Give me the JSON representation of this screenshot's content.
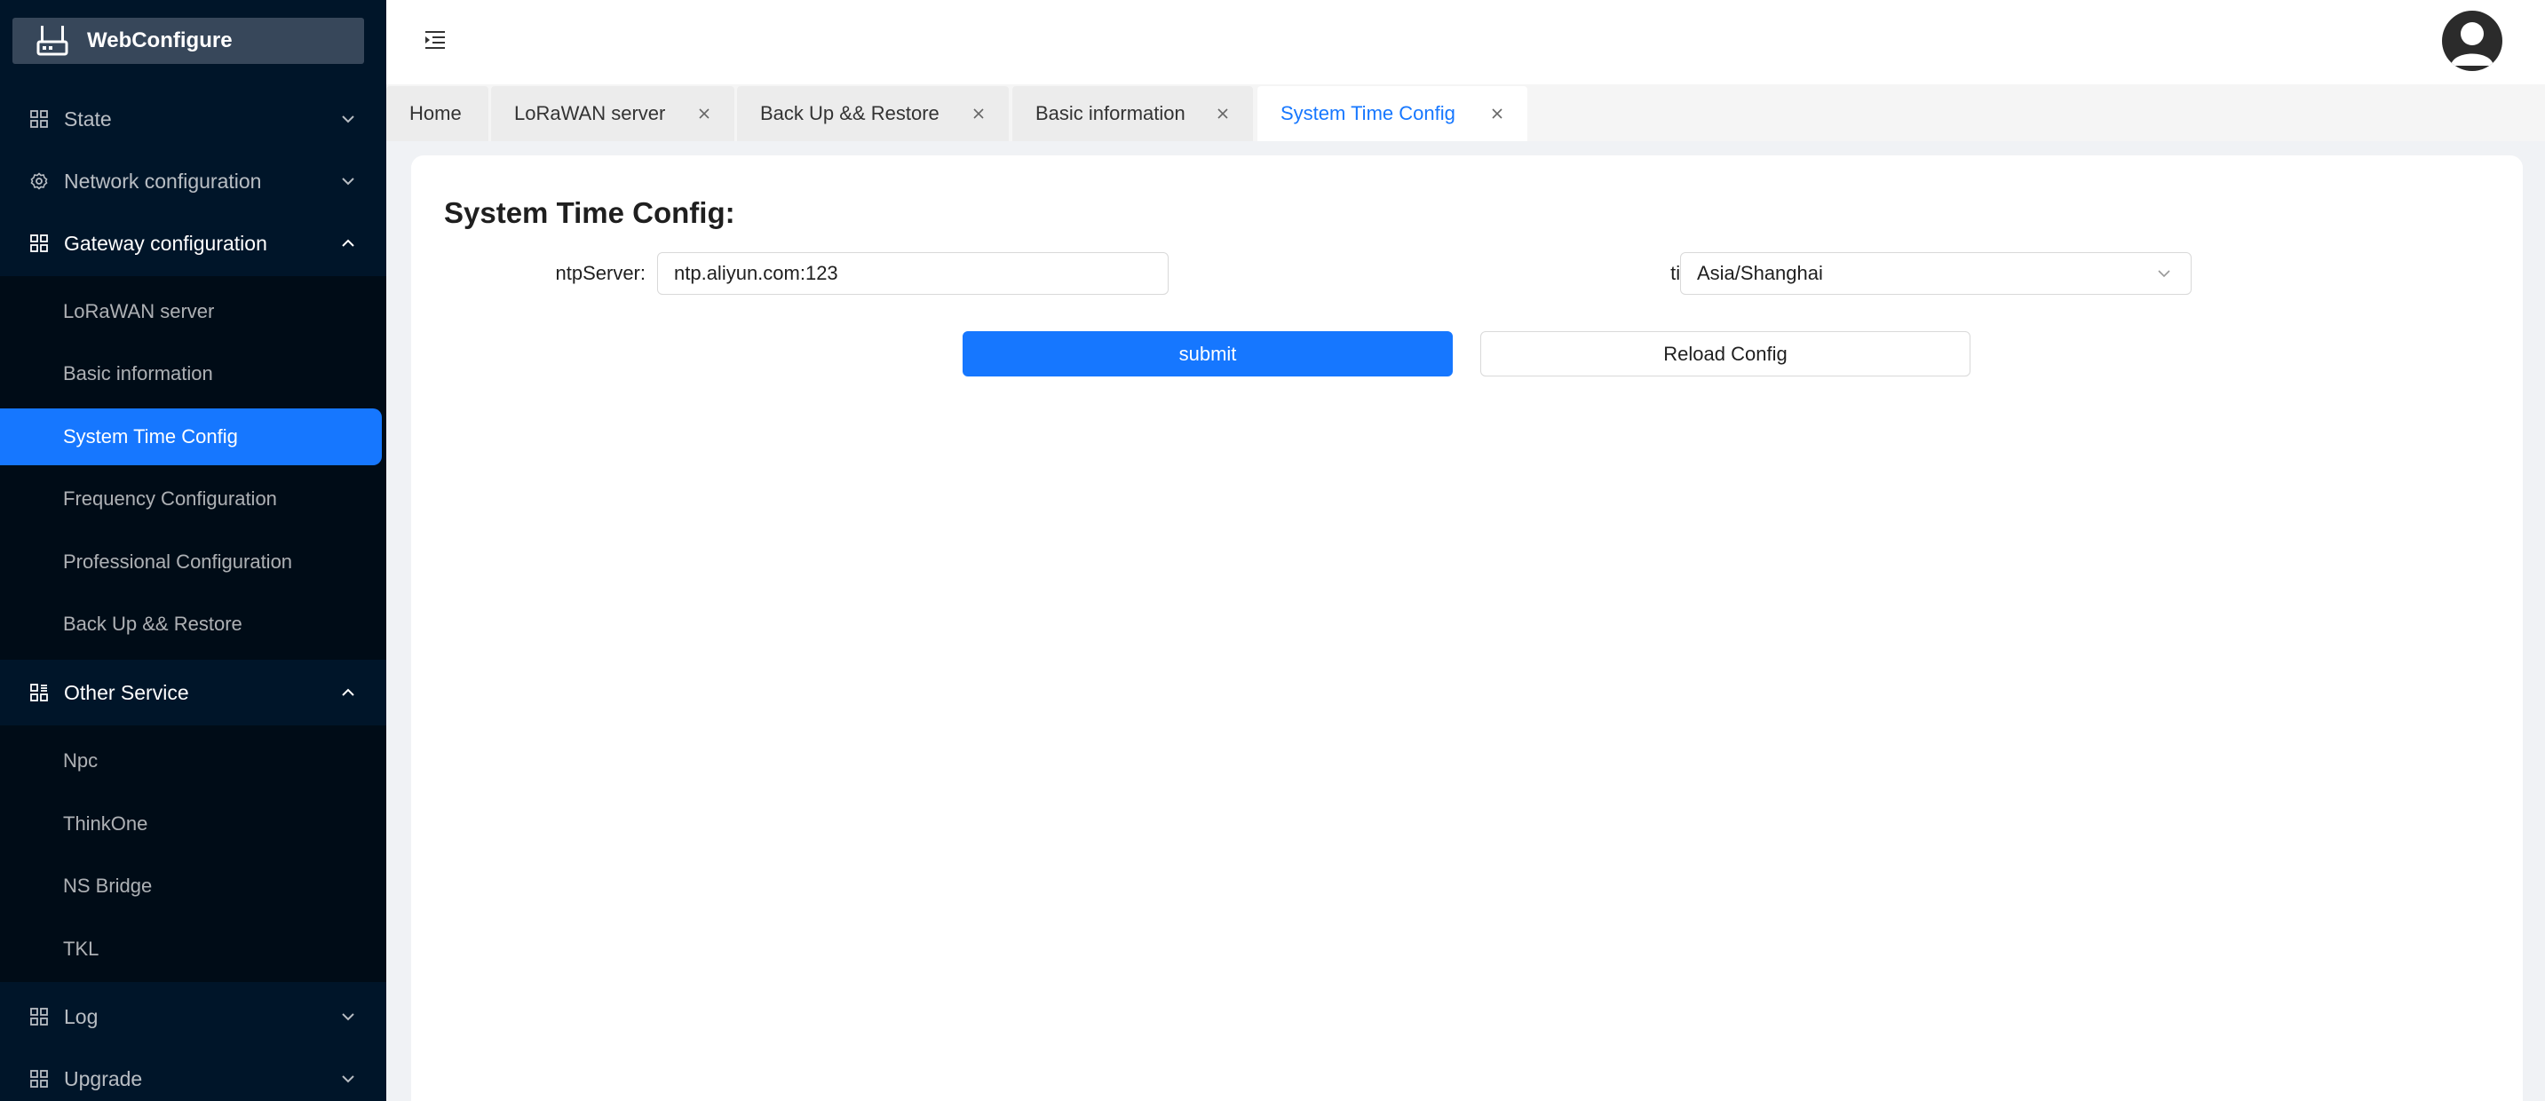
{
  "app": {
    "logo_text": "WebConfigure"
  },
  "sidebar": {
    "groups": {
      "state": {
        "label": "State"
      },
      "network": {
        "label": "Network configuration"
      },
      "gateway": {
        "label": "Gateway configuration",
        "items": [
          "LoRaWAN server",
          "Basic information",
          "System Time Config",
          "Frequency Configuration",
          "Professional Configuration",
          "Back Up && Restore"
        ]
      },
      "other": {
        "label": "Other Service",
        "items": [
          "Npc",
          "ThinkOne",
          "NS Bridge",
          "TKL"
        ]
      },
      "log": {
        "label": "Log"
      },
      "upgrade": {
        "label": "Upgrade"
      }
    },
    "active_item": "System Time Config"
  },
  "tabs": [
    {
      "label": "Home"
    },
    {
      "label": "LoRaWAN server"
    },
    {
      "label": "Back Up && Restore"
    },
    {
      "label": "Basic information"
    },
    {
      "label": "System Time Config"
    }
  ],
  "form": {
    "title": "System Time Config:",
    "ntp_label": "ntpServer:",
    "ntp_value": "ntp.aliyun.com:123",
    "timezone_label": "timeZone:",
    "timezone_value": "Asia/Shanghai",
    "submit_label": "submit",
    "reload_label": "Reload Config"
  },
  "colors": {
    "sidebar_bg": "#001529",
    "accent": "#1677ff"
  }
}
